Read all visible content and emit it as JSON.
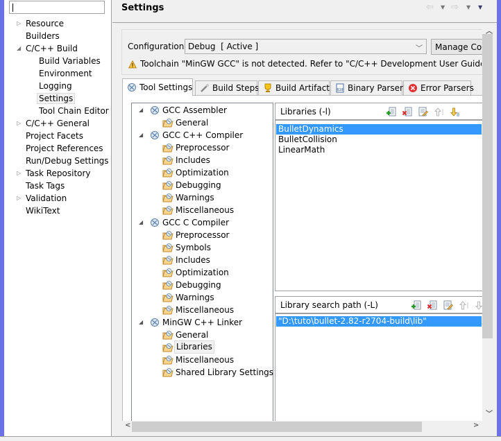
{
  "left_nav": {
    "filter": {
      "value": "",
      "placeholder": ""
    },
    "items": [
      {
        "label": "Resource",
        "level": 0,
        "expander": "collapsed"
      },
      {
        "label": "Builders",
        "level": 0,
        "expander": "none"
      },
      {
        "label": "C/C++ Build",
        "level": 0,
        "expander": "expanded"
      },
      {
        "label": "Build Variables",
        "level": 1,
        "expander": "none"
      },
      {
        "label": "Environment",
        "level": 1,
        "expander": "none"
      },
      {
        "label": "Logging",
        "level": 1,
        "expander": "none"
      },
      {
        "label": "Settings",
        "level": 1,
        "expander": "none",
        "selected": true
      },
      {
        "label": "Tool Chain Editor",
        "level": 1,
        "expander": "none"
      },
      {
        "label": "C/C++ General",
        "level": 0,
        "expander": "collapsed"
      },
      {
        "label": "Project Facets",
        "level": 0,
        "expander": "none"
      },
      {
        "label": "Project References",
        "level": 0,
        "expander": "none"
      },
      {
        "label": "Run/Debug Settings",
        "level": 0,
        "expander": "none"
      },
      {
        "label": "Task Repository",
        "level": 0,
        "expander": "collapsed"
      },
      {
        "label": "Task Tags",
        "level": 0,
        "expander": "none"
      },
      {
        "label": "Validation",
        "level": 0,
        "expander": "collapsed"
      },
      {
        "label": "WikiText",
        "level": 0,
        "expander": "none"
      }
    ]
  },
  "header": {
    "title": "Settings",
    "icons": [
      "back-arrow-icon",
      "back-menu-icon",
      "forward-arrow-icon",
      "forward-menu-icon",
      "view-menu-icon"
    ]
  },
  "configuration": {
    "label": "Configuration:",
    "selected": "Debug  [ Active ]",
    "manage_button": "Manage Configurations...",
    "manage_button_visible": "Manage Cor",
    "warning": "Toolchain \"MinGW GCC\" is not detected. Refer to \"C/C++ Development User Guide\", \"Before"
  },
  "tabs": [
    {
      "label": "Tool Settings",
      "icon": "tool-settings-icon",
      "active": true
    },
    {
      "label": "Build Steps",
      "icon": "build-steps-icon"
    },
    {
      "label": "Build Artifact",
      "icon": "build-artifact-icon"
    },
    {
      "label": "Binary Parsers",
      "icon": "binary-parsers-icon"
    },
    {
      "label": "Error Parsers",
      "icon": "error-parsers-icon"
    }
  ],
  "tool_tree": [
    {
      "label": "GCC Assembler",
      "type": "tool",
      "children": [
        "General"
      ]
    },
    {
      "label": "GCC C++ Compiler",
      "type": "tool",
      "children": [
        "Preprocessor",
        "Includes",
        "Optimization",
        "Debugging",
        "Warnings",
        "Miscellaneous"
      ]
    },
    {
      "label": "GCC C Compiler",
      "type": "tool",
      "children": [
        "Preprocessor",
        "Symbols",
        "Includes",
        "Optimization",
        "Debugging",
        "Warnings",
        "Miscellaneous"
      ]
    },
    {
      "label": "MinGW C++ Linker",
      "type": "tool",
      "children": [
        "General",
        "Libraries",
        "Miscellaneous",
        "Shared Library Settings"
      ]
    }
  ],
  "selected_tree_item": "MinGW C++ Linker > Libraries",
  "libraries": {
    "label": "Libraries (-l)",
    "items": [
      "BulletDynamics",
      "BulletCollision",
      "LinearMath"
    ],
    "selected_index": 0,
    "tools": [
      "add-icon",
      "delete-icon",
      "edit-icon",
      "move-up-icon",
      "move-down-icon"
    ]
  },
  "library_paths": {
    "label": "Library search path (-L)",
    "items": [
      "\"D:\\tuto\\bullet-2.82-r2704-build\\lib\""
    ],
    "selected_index": 0,
    "tools": [
      "add-icon",
      "delete-icon",
      "edit-icon",
      "move-up-icon",
      "move-down-icon"
    ]
  },
  "colors": {
    "selection": "#3399ff",
    "accent_edge": "#6b72e6",
    "background": "#f0f0f0"
  }
}
